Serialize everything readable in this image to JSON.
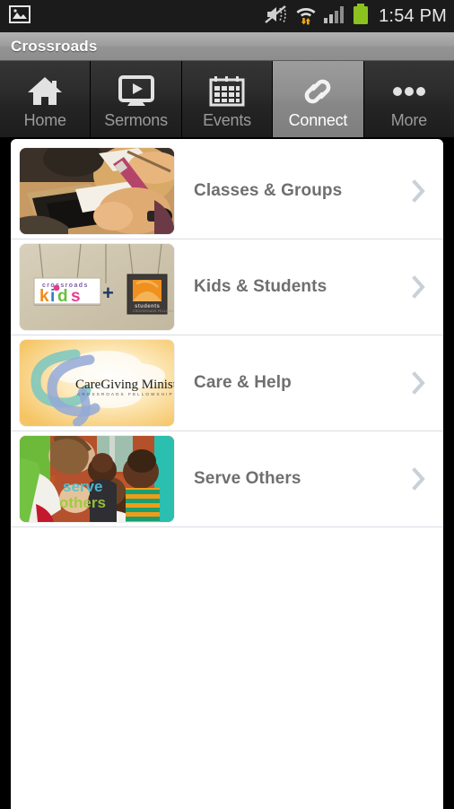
{
  "statusbar": {
    "time": "1:54 PM",
    "icons": [
      {
        "name": "photo-icon"
      },
      {
        "name": "vibrate-muted-icon"
      },
      {
        "name": "wifi-transfer-icon"
      },
      {
        "name": "cellular-signal-icon"
      },
      {
        "name": "battery-icon"
      }
    ],
    "battery_color": "#8bc220"
  },
  "titlebar": {
    "title": "Crossroads"
  },
  "tabs": [
    {
      "label": "Home",
      "icon": "home-icon",
      "active": false
    },
    {
      "label": "Sermons",
      "icon": "video-monitor-icon",
      "active": false
    },
    {
      "label": "Events",
      "icon": "calendar-icon",
      "active": false
    },
    {
      "label": "Connect",
      "icon": "link-chain-icon",
      "active": true
    },
    {
      "label": "More",
      "icon": "ellipsis-icon",
      "active": false
    }
  ],
  "list": {
    "items": [
      {
        "label": "Classes & Groups",
        "thumb": "classes-groups-thumbnail",
        "chevron": "chevron-right-icon"
      },
      {
        "label": "Kids & Students",
        "thumb": "kids-students-thumbnail",
        "thumb_text": {
          "brand_small": "crossroads",
          "brand_big": "kids",
          "plus": "+",
          "students": "students"
        },
        "chevron": "chevron-right-icon"
      },
      {
        "label": "Care & Help",
        "thumb": "caregiving-ministries-thumbnail",
        "thumb_text": {
          "main": "CareGiving Ministries",
          "sub": "CROSSROADS FELLOWSHIP"
        },
        "chevron": "chevron-right-icon"
      },
      {
        "label": "Serve Others",
        "thumb": "serve-others-thumbnail",
        "thumb_text": {
          "line1": "serve",
          "line2": "others"
        },
        "chevron": "chevron-right-icon"
      }
    ]
  },
  "colors": {
    "accent_active_tab": "#8f8f8f",
    "label_text": "#6f6f6f",
    "divider": "#d9dde4",
    "chevron": "#c9d0da",
    "card_bg": "#ffffff",
    "screen_bg": "#000000"
  }
}
